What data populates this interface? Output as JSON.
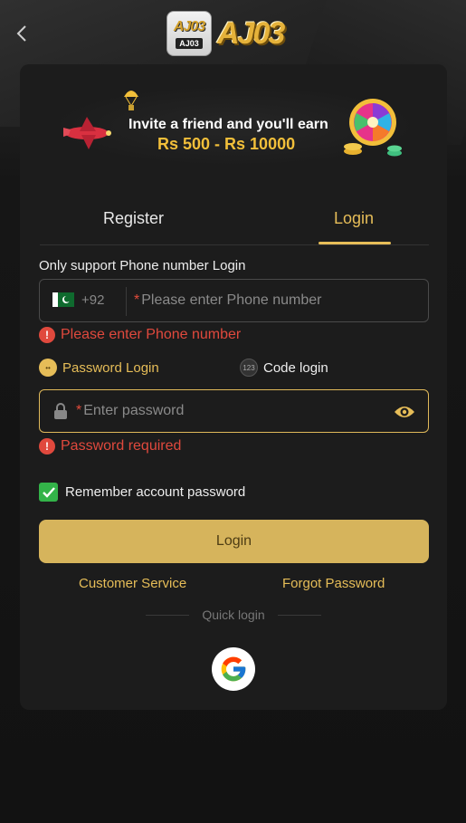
{
  "header": {
    "back_icon": "chevron-left-icon",
    "logo_tile_text": "AJ03",
    "logo_tile_sub": "AJ03",
    "logo_text": "AJ03"
  },
  "banner": {
    "line1": "Invite a friend and you'll earn",
    "line2": "Rs 500 - Rs 10000"
  },
  "tabs": [
    {
      "label": "Register",
      "active": false
    },
    {
      "label": "Login",
      "active": true
    }
  ],
  "form": {
    "note": "Only support Phone number Login",
    "country_code": "+92",
    "phone_placeholder": "Please enter Phone number",
    "phone_error": "Please enter Phone number",
    "mode_password": "Password Login",
    "mode_code": "Code login",
    "password_placeholder": "Enter password",
    "password_error": "Password required",
    "required_mark": "*",
    "remember_label": "Remember account password",
    "remember_checked": true,
    "login_button": "Login",
    "customer_service": "Customer Service",
    "forgot_password": "Forgot Password",
    "quick_login": "Quick login"
  },
  "colors": {
    "accent": "#e6bd58",
    "button": "#d6b45c",
    "error": "#e0493d",
    "check": "#33b349"
  }
}
